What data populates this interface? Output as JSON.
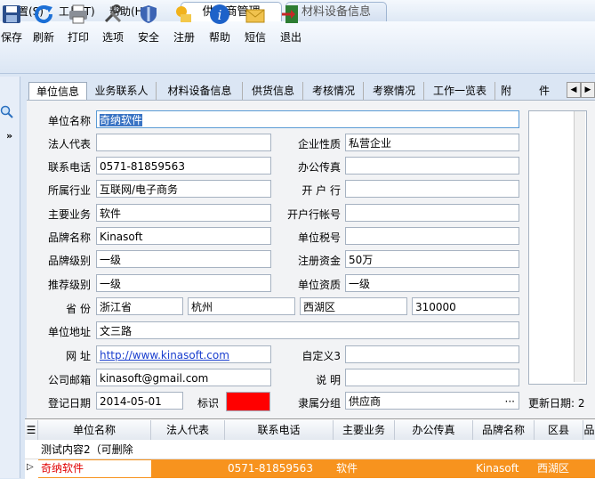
{
  "menu": [
    "设置(S)",
    "工具(T)",
    "帮助(H)"
  ],
  "top_tabs": {
    "supplier": "供应商管理",
    "material": "材料设备信息"
  },
  "toolbar": [
    "保存",
    "刷新",
    "打印",
    "选项",
    "安全",
    "注册",
    "帮助",
    "短信",
    "退出"
  ],
  "form_tabs": [
    "单位信息",
    "业务联系人",
    "材料设备信息",
    "供货信息",
    "考核情况",
    "考察情况",
    "工作一览表",
    "附",
    "件"
  ],
  "form": {
    "unit_name_label": "单位名称",
    "unit_name": "奇纳软件",
    "legal_rep_label": "法人代表",
    "legal_rep": "",
    "company_type_label": "企业性质",
    "company_type": "私营企业",
    "phone_label": "联系电话",
    "phone": "0571-81859563",
    "fax_label": "办公传真",
    "fax": "",
    "industry_label": "所属行业",
    "industry": "互联网/电子商务",
    "bank_label": "开 户 行",
    "bank": "",
    "business_label": "主要业务",
    "business": "软件",
    "bank_account_label": "开户行帐号",
    "bank_account": "",
    "brand_label": "品牌名称",
    "brand": "Kinasoft",
    "tax_label": "单位税号",
    "tax": "",
    "brand_level_label": "品牌级别",
    "brand_level": "一级",
    "capital_label": "注册资金",
    "capital": "50万",
    "recommend_label": "推荐级别",
    "recommend": "一级",
    "qualification_label": "单位资质",
    "qualification": "一级",
    "province_label": "省    份",
    "province": "浙江省",
    "city": "杭州",
    "district": "西湖区",
    "postcode": "310000",
    "address_label": "单位地址",
    "address": "文三路",
    "website_label": "网    址",
    "website": "http://www.kinasoft.com",
    "custom3_label": "自定义3",
    "custom3": "",
    "email_label": "公司邮箱",
    "email": "kinasoft@gmail.com",
    "note_label": "说    明",
    "note": "",
    "reg_date_label": "登记日期",
    "reg_date": "2014-05-01",
    "mark_label": "标识",
    "group_label": "隶属分组",
    "group": "供应商",
    "group_btn": "···",
    "update_label": "更新日期: 2"
  },
  "mark_color": "#ff0000",
  "grid": {
    "headers": [
      "单位名称",
      "法人代表",
      "联系电话",
      "主要业务",
      "办公传真",
      "品牌名称",
      "区县",
      "品"
    ],
    "rows": [
      [
        "测试内容2（可删除",
        "",
        "",
        "",
        "",
        "",
        "",
        ""
      ],
      [
        "奇纳软件",
        "",
        "0571-81859563",
        "软件",
        "",
        "Kinasoft",
        "西湖区",
        ""
      ]
    ]
  },
  "selected_row_color": "#f7931e"
}
